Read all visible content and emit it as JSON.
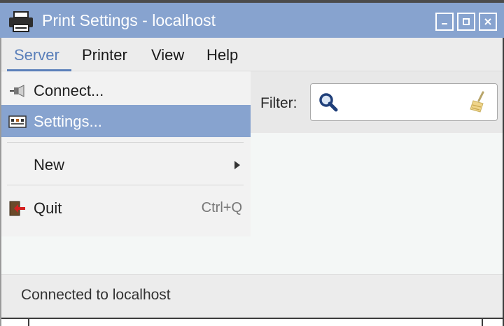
{
  "window": {
    "title": "Print Settings - localhost",
    "controls": {
      "minimize": "minimize-icon",
      "maximize": "maximize-icon",
      "close": "close-icon"
    }
  },
  "menubar": {
    "items": [
      {
        "label": "Server",
        "active": true
      },
      {
        "label": "Printer"
      },
      {
        "label": "View"
      },
      {
        "label": "Help"
      }
    ]
  },
  "server_menu": {
    "items": [
      {
        "label": "Connect...",
        "icon": "connect-plug-icon"
      },
      {
        "label": "Settings...",
        "icon": "settings-icon",
        "highlighted": true
      },
      {
        "label": "New",
        "submenu": true
      },
      {
        "label": "Quit",
        "icon": "quit-door-icon",
        "accelerator": "Ctrl+Q"
      }
    ]
  },
  "filter": {
    "label": "Filter:",
    "value": "",
    "icons": [
      "search-icon",
      "clear-broom-icon"
    ]
  },
  "status": {
    "text": "Connected to localhost"
  },
  "colors": {
    "titlebar": "#87a3cf",
    "highlight": "#87a3cf",
    "active_menu_text": "#5a7fba"
  }
}
